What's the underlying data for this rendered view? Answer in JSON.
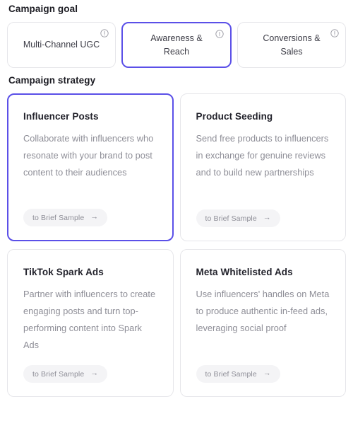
{
  "theme": {
    "accent": "#5b50e8",
    "border": "#e6e6ea",
    "title_color": "#22222b",
    "body_color": "#8e8e97",
    "chip_bg": "#f4f4f6",
    "background": "#ffffff"
  },
  "goal_section": {
    "heading": "Campaign goal",
    "tabs": [
      {
        "label": "Multi-Channel UGC",
        "selected": false,
        "info_icon": "info-circle-icon"
      },
      {
        "label": "Awareness & Reach",
        "selected": true,
        "info_icon": "info-circle-icon"
      },
      {
        "label": "Conversions & Sales",
        "selected": false,
        "info_icon": "info-circle-icon"
      }
    ]
  },
  "strategy_section": {
    "heading": "Campaign strategy",
    "cards": [
      {
        "title": "Influencer Posts",
        "description": "Collaborate with influencers who resonate with your brand to post content to their audiences",
        "cta_label": "to Brief Sample",
        "cta_icon": "arrow-right-icon",
        "selected": true
      },
      {
        "title": "Product Seeding",
        "description": "Send free products to influencers in exchange for genuine reviews and to build new partnerships",
        "cta_label": "to Brief Sample",
        "cta_icon": "arrow-right-icon",
        "selected": false
      },
      {
        "title": "TikTok Spark Ads",
        "description": "Partner with influencers to create engaging posts and turn top-performing content into Spark Ads",
        "cta_label": "to Brief Sample",
        "cta_icon": "arrow-right-icon",
        "selected": false
      },
      {
        "title": "Meta Whitelisted Ads",
        "description": "Use influencers' handles on Meta to produce authentic in-feed ads, leveraging social proof",
        "cta_label": "to Brief Sample",
        "cta_icon": "arrow-right-icon",
        "selected": false
      }
    ]
  }
}
